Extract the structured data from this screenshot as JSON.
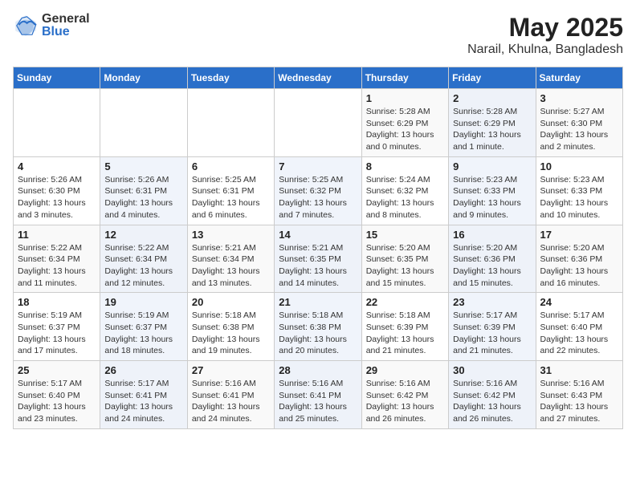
{
  "header": {
    "logo_general": "General",
    "logo_blue": "Blue",
    "title": "May 2025",
    "subtitle": "Narail, Khulna, Bangladesh"
  },
  "calendar": {
    "days_of_week": [
      "Sunday",
      "Monday",
      "Tuesday",
      "Wednesday",
      "Thursday",
      "Friday",
      "Saturday"
    ],
    "weeks": [
      [
        {
          "day": "",
          "info": ""
        },
        {
          "day": "",
          "info": ""
        },
        {
          "day": "",
          "info": ""
        },
        {
          "day": "",
          "info": ""
        },
        {
          "day": "1",
          "info": "Sunrise: 5:28 AM\nSunset: 6:29 PM\nDaylight: 13 hours\nand 0 minutes."
        },
        {
          "day": "2",
          "info": "Sunrise: 5:28 AM\nSunset: 6:29 PM\nDaylight: 13 hours\nand 1 minute."
        },
        {
          "day": "3",
          "info": "Sunrise: 5:27 AM\nSunset: 6:30 PM\nDaylight: 13 hours\nand 2 minutes."
        }
      ],
      [
        {
          "day": "4",
          "info": "Sunrise: 5:26 AM\nSunset: 6:30 PM\nDaylight: 13 hours\nand 3 minutes."
        },
        {
          "day": "5",
          "info": "Sunrise: 5:26 AM\nSunset: 6:31 PM\nDaylight: 13 hours\nand 4 minutes."
        },
        {
          "day": "6",
          "info": "Sunrise: 5:25 AM\nSunset: 6:31 PM\nDaylight: 13 hours\nand 6 minutes."
        },
        {
          "day": "7",
          "info": "Sunrise: 5:25 AM\nSunset: 6:32 PM\nDaylight: 13 hours\nand 7 minutes."
        },
        {
          "day": "8",
          "info": "Sunrise: 5:24 AM\nSunset: 6:32 PM\nDaylight: 13 hours\nand 8 minutes."
        },
        {
          "day": "9",
          "info": "Sunrise: 5:23 AM\nSunset: 6:33 PM\nDaylight: 13 hours\nand 9 minutes."
        },
        {
          "day": "10",
          "info": "Sunrise: 5:23 AM\nSunset: 6:33 PM\nDaylight: 13 hours\nand 10 minutes."
        }
      ],
      [
        {
          "day": "11",
          "info": "Sunrise: 5:22 AM\nSunset: 6:34 PM\nDaylight: 13 hours\nand 11 minutes."
        },
        {
          "day": "12",
          "info": "Sunrise: 5:22 AM\nSunset: 6:34 PM\nDaylight: 13 hours\nand 12 minutes."
        },
        {
          "day": "13",
          "info": "Sunrise: 5:21 AM\nSunset: 6:34 PM\nDaylight: 13 hours\nand 13 minutes."
        },
        {
          "day": "14",
          "info": "Sunrise: 5:21 AM\nSunset: 6:35 PM\nDaylight: 13 hours\nand 14 minutes."
        },
        {
          "day": "15",
          "info": "Sunrise: 5:20 AM\nSunset: 6:35 PM\nDaylight: 13 hours\nand 15 minutes."
        },
        {
          "day": "16",
          "info": "Sunrise: 5:20 AM\nSunset: 6:36 PM\nDaylight: 13 hours\nand 15 minutes."
        },
        {
          "day": "17",
          "info": "Sunrise: 5:20 AM\nSunset: 6:36 PM\nDaylight: 13 hours\nand 16 minutes."
        }
      ],
      [
        {
          "day": "18",
          "info": "Sunrise: 5:19 AM\nSunset: 6:37 PM\nDaylight: 13 hours\nand 17 minutes."
        },
        {
          "day": "19",
          "info": "Sunrise: 5:19 AM\nSunset: 6:37 PM\nDaylight: 13 hours\nand 18 minutes."
        },
        {
          "day": "20",
          "info": "Sunrise: 5:18 AM\nSunset: 6:38 PM\nDaylight: 13 hours\nand 19 minutes."
        },
        {
          "day": "21",
          "info": "Sunrise: 5:18 AM\nSunset: 6:38 PM\nDaylight: 13 hours\nand 20 minutes."
        },
        {
          "day": "22",
          "info": "Sunrise: 5:18 AM\nSunset: 6:39 PM\nDaylight: 13 hours\nand 21 minutes."
        },
        {
          "day": "23",
          "info": "Sunrise: 5:17 AM\nSunset: 6:39 PM\nDaylight: 13 hours\nand 21 minutes."
        },
        {
          "day": "24",
          "info": "Sunrise: 5:17 AM\nSunset: 6:40 PM\nDaylight: 13 hours\nand 22 minutes."
        }
      ],
      [
        {
          "day": "25",
          "info": "Sunrise: 5:17 AM\nSunset: 6:40 PM\nDaylight: 13 hours\nand 23 minutes."
        },
        {
          "day": "26",
          "info": "Sunrise: 5:17 AM\nSunset: 6:41 PM\nDaylight: 13 hours\nand 24 minutes."
        },
        {
          "day": "27",
          "info": "Sunrise: 5:16 AM\nSunset: 6:41 PM\nDaylight: 13 hours\nand 24 minutes."
        },
        {
          "day": "28",
          "info": "Sunrise: 5:16 AM\nSunset: 6:41 PM\nDaylight: 13 hours\nand 25 minutes."
        },
        {
          "day": "29",
          "info": "Sunrise: 5:16 AM\nSunset: 6:42 PM\nDaylight: 13 hours\nand 26 minutes."
        },
        {
          "day": "30",
          "info": "Sunrise: 5:16 AM\nSunset: 6:42 PM\nDaylight: 13 hours\nand 26 minutes."
        },
        {
          "day": "31",
          "info": "Sunrise: 5:16 AM\nSunset: 6:43 PM\nDaylight: 13 hours\nand 27 minutes."
        }
      ]
    ]
  }
}
